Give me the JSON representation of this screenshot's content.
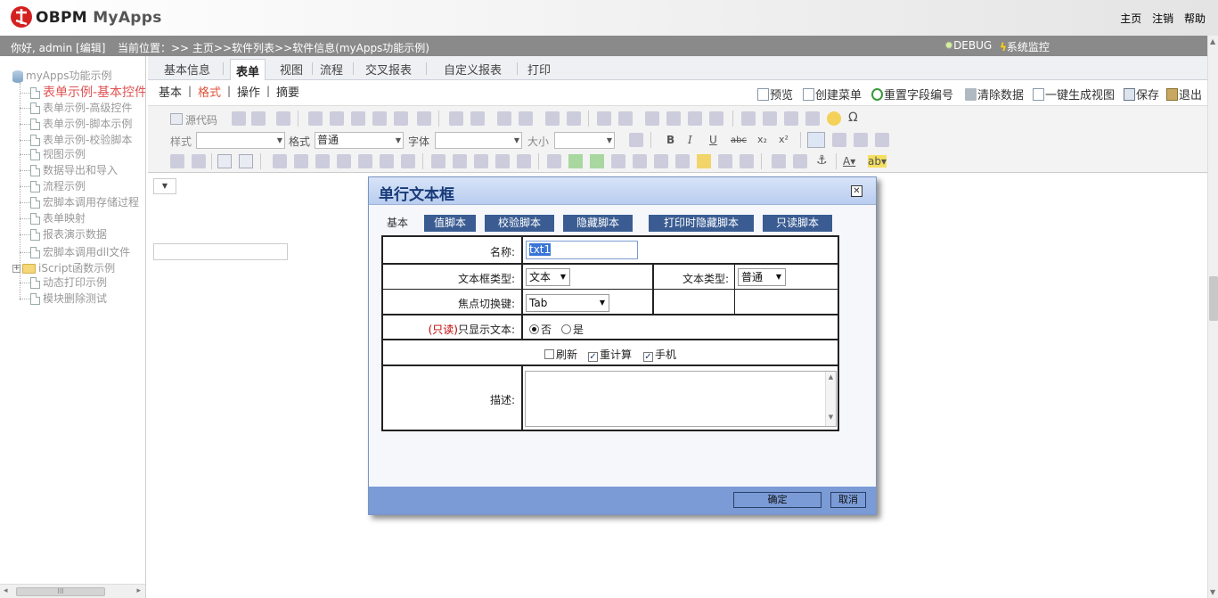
{
  "header": {
    "app_title": "OBPM",
    "app_subtitle": "MyApps",
    "links": [
      "主页",
      "注销",
      "帮助"
    ]
  },
  "status": {
    "greeting": "你好, admin [编辑]",
    "location": "当前位置：>> 主页>>软件列表>>软件信息(myApps功能示例)",
    "debug": "DEBUG",
    "monitor": "系统监控"
  },
  "tree": {
    "root": "myApps功能示例",
    "items": [
      "表单示例-基本控件",
      "表单示例-高级控件",
      "表单示例-脚本示例",
      "表单示例-校验脚本",
      "视图示例",
      "数据导出和导入",
      "流程示例",
      "宏脚本调用存储过程",
      "表单映射",
      "报表演示数据",
      "宏脚本调用dll文件",
      "iScript函数示例",
      "动态打印示例",
      "模块删除测试"
    ],
    "scroll_thumb": "III"
  },
  "main_tabs": [
    "基本信息",
    "表单",
    "视图",
    "流程",
    "交叉报表",
    "自定义报表",
    "打印"
  ],
  "sub_tabs": [
    "基本",
    "格式",
    "操作",
    "摘要"
  ],
  "actions": [
    "预览",
    "创建菜单",
    "重置字段编号",
    "清除数据",
    "一键生成视图",
    "保存",
    "退出"
  ],
  "toolbar": {
    "source": "源代码",
    "style_label": "样式",
    "format_label": "格式",
    "format_value": "普通",
    "font_label": "字体",
    "size_label": "大小"
  },
  "dialog": {
    "title": "单行文本框",
    "close": "☒",
    "tabs": [
      "基本",
      "值脚本",
      "校验脚本",
      "隐藏脚本",
      "打印时隐藏脚本",
      "只读脚本"
    ],
    "name_label": "名称:",
    "name_value": "txt1",
    "textbox_type_label": "文本框类型:",
    "textbox_type_value": "文本",
    "text_type_label": "文本类型:",
    "text_type_value": "普通",
    "focus_key_label": "焦点切换键:",
    "focus_key_value": "Tab",
    "readonly_prefix": "(只读)",
    "readonly_label": "只显示文本:",
    "radio_no": "否",
    "radio_yes": "是",
    "check_refresh": "刷新",
    "check_recalc": "重计算",
    "check_mobile": "手机",
    "desc_label": "描述:",
    "ok": "确定",
    "cancel": "取消"
  }
}
